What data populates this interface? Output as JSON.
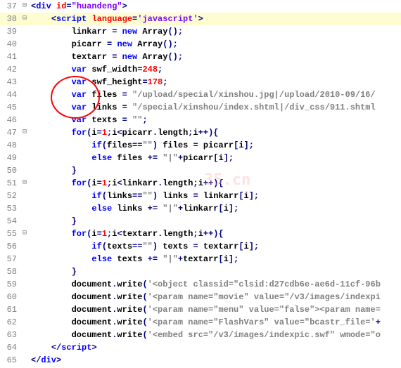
{
  "watermark": "35.cn",
  "lines": [
    {
      "n": 37,
      "fold": "⊟",
      "indent": 0,
      "hl": false,
      "tokens": [
        {
          "c": "op",
          "t": "<"
        },
        {
          "c": "tag",
          "t": "div "
        },
        {
          "c": "attrn",
          "t": "id"
        },
        {
          "c": "op",
          "t": "="
        },
        {
          "c": "attrv",
          "t": "\"huandeng\""
        },
        {
          "c": "op",
          "t": ">"
        }
      ]
    },
    {
      "n": 38,
      "fold": "⊟",
      "indent": 1,
      "hl": true,
      "tokens": [
        {
          "c": "op",
          "t": "<"
        },
        {
          "c": "tag",
          "t": "script "
        },
        {
          "c": "attrn",
          "t": "language"
        },
        {
          "c": "op",
          "t": "="
        },
        {
          "c": "attrv",
          "t": "'javascript'"
        },
        {
          "c": "op",
          "t": ">"
        }
      ]
    },
    {
      "n": 39,
      "fold": "",
      "indent": 2,
      "hl": false,
      "tokens": [
        {
          "c": "ident",
          "t": "linkarr "
        },
        {
          "c": "op",
          "t": "= "
        },
        {
          "c": "kw",
          "t": "new"
        },
        {
          "c": "ident",
          "t": " Array"
        },
        {
          "c": "op",
          "t": "();"
        }
      ]
    },
    {
      "n": 40,
      "fold": "",
      "indent": 2,
      "hl": false,
      "tokens": [
        {
          "c": "ident",
          "t": "picarr "
        },
        {
          "c": "op",
          "t": "= "
        },
        {
          "c": "kw",
          "t": "new"
        },
        {
          "c": "ident",
          "t": " Array"
        },
        {
          "c": "op",
          "t": "();"
        }
      ]
    },
    {
      "n": 41,
      "fold": "",
      "indent": 2,
      "hl": false,
      "tokens": [
        {
          "c": "ident",
          "t": "textarr "
        },
        {
          "c": "op",
          "t": "= "
        },
        {
          "c": "kw",
          "t": "new"
        },
        {
          "c": "ident",
          "t": " Array"
        },
        {
          "c": "op",
          "t": "();"
        }
      ]
    },
    {
      "n": 42,
      "fold": "",
      "indent": 2,
      "hl": false,
      "tokens": [
        {
          "c": "kw",
          "t": "var"
        },
        {
          "c": "ident",
          "t": " swf_width"
        },
        {
          "c": "op",
          "t": "="
        },
        {
          "c": "num",
          "t": "248"
        },
        {
          "c": "op",
          "t": ";"
        }
      ]
    },
    {
      "n": 43,
      "fold": "",
      "indent": 2,
      "hl": false,
      "tokens": [
        {
          "c": "kw",
          "t": "var"
        },
        {
          "c": "ident",
          "t": " swf_height"
        },
        {
          "c": "op",
          "t": "="
        },
        {
          "c": "num",
          "t": "178"
        },
        {
          "c": "op",
          "t": ";"
        }
      ]
    },
    {
      "n": 44,
      "fold": "",
      "indent": 2,
      "hl": false,
      "tokens": [
        {
          "c": "kw",
          "t": "var"
        },
        {
          "c": "ident",
          "t": " files "
        },
        {
          "c": "op",
          "t": "= "
        },
        {
          "c": "str",
          "t": "\"/upload/special/xinshou.jpg|/upload/2010-09/16/"
        }
      ]
    },
    {
      "n": 45,
      "fold": "",
      "indent": 2,
      "hl": false,
      "tokens": [
        {
          "c": "kw",
          "t": "var"
        },
        {
          "c": "ident",
          "t": " links "
        },
        {
          "c": "op",
          "t": "= "
        },
        {
          "c": "str",
          "t": "\"/special/xinshou/index.shtml|/div_css/911.shtml"
        }
      ]
    },
    {
      "n": 46,
      "fold": "",
      "indent": 2,
      "hl": false,
      "tokens": [
        {
          "c": "kw",
          "t": "var"
        },
        {
          "c": "ident",
          "t": " texts "
        },
        {
          "c": "op",
          "t": "= "
        },
        {
          "c": "str",
          "t": "\"\""
        },
        {
          "c": "op",
          "t": ";"
        }
      ]
    },
    {
      "n": 47,
      "fold": "⊟",
      "indent": 2,
      "hl": false,
      "tokens": [
        {
          "c": "kw",
          "t": "for"
        },
        {
          "c": "op",
          "t": "("
        },
        {
          "c": "ident",
          "t": "i"
        },
        {
          "c": "op",
          "t": "="
        },
        {
          "c": "num",
          "t": "1"
        },
        {
          "c": "op",
          "t": ";"
        },
        {
          "c": "ident",
          "t": "i"
        },
        {
          "c": "op",
          "t": "<"
        },
        {
          "c": "ident",
          "t": "picarr"
        },
        {
          "c": "op",
          "t": "."
        },
        {
          "c": "ident",
          "t": "length"
        },
        {
          "c": "op",
          "t": ";"
        },
        {
          "c": "ident",
          "t": "i"
        },
        {
          "c": "op",
          "t": "++){"
        }
      ]
    },
    {
      "n": 48,
      "fold": "",
      "indent": 3,
      "hl": false,
      "tokens": [
        {
          "c": "kw",
          "t": "if"
        },
        {
          "c": "op",
          "t": "("
        },
        {
          "c": "ident",
          "t": "files"
        },
        {
          "c": "op",
          "t": "=="
        },
        {
          "c": "str",
          "t": "\"\""
        },
        {
          "c": "op",
          "t": ") "
        },
        {
          "c": "ident",
          "t": "files "
        },
        {
          "c": "op",
          "t": "= "
        },
        {
          "c": "ident",
          "t": "picarr"
        },
        {
          "c": "op",
          "t": "["
        },
        {
          "c": "ident",
          "t": "i"
        },
        {
          "c": "op",
          "t": "];"
        }
      ]
    },
    {
      "n": 49,
      "fold": "",
      "indent": 3,
      "hl": false,
      "tokens": [
        {
          "c": "kw",
          "t": "else"
        },
        {
          "c": "ident",
          "t": " files "
        },
        {
          "c": "op",
          "t": "+= "
        },
        {
          "c": "str",
          "t": "\"|\""
        },
        {
          "c": "op",
          "t": "+"
        },
        {
          "c": "ident",
          "t": "picarr"
        },
        {
          "c": "op",
          "t": "["
        },
        {
          "c": "ident",
          "t": "i"
        },
        {
          "c": "op",
          "t": "];"
        }
      ]
    },
    {
      "n": 50,
      "fold": "",
      "indent": 2,
      "hl": false,
      "tokens": [
        {
          "c": "op",
          "t": "}"
        }
      ]
    },
    {
      "n": 51,
      "fold": "⊟",
      "indent": 2,
      "hl": false,
      "tokens": [
        {
          "c": "kw",
          "t": "for"
        },
        {
          "c": "op",
          "t": "("
        },
        {
          "c": "ident",
          "t": "i"
        },
        {
          "c": "op",
          "t": "="
        },
        {
          "c": "num",
          "t": "1"
        },
        {
          "c": "op",
          "t": ";"
        },
        {
          "c": "ident",
          "t": "i"
        },
        {
          "c": "op",
          "t": "<"
        },
        {
          "c": "ident",
          "t": "linkarr"
        },
        {
          "c": "op",
          "t": "."
        },
        {
          "c": "ident",
          "t": "length"
        },
        {
          "c": "op",
          "t": ";"
        },
        {
          "c": "ident",
          "t": "i"
        },
        {
          "c": "op",
          "t": "++){"
        }
      ]
    },
    {
      "n": 52,
      "fold": "",
      "indent": 3,
      "hl": false,
      "tokens": [
        {
          "c": "kw",
          "t": "if"
        },
        {
          "c": "op",
          "t": "("
        },
        {
          "c": "ident",
          "t": "links"
        },
        {
          "c": "op",
          "t": "=="
        },
        {
          "c": "str",
          "t": "\"\""
        },
        {
          "c": "op",
          "t": ") "
        },
        {
          "c": "ident",
          "t": "links "
        },
        {
          "c": "op",
          "t": "= "
        },
        {
          "c": "ident",
          "t": "linkarr"
        },
        {
          "c": "op",
          "t": "["
        },
        {
          "c": "ident",
          "t": "i"
        },
        {
          "c": "op",
          "t": "];"
        }
      ]
    },
    {
      "n": 53,
      "fold": "",
      "indent": 3,
      "hl": false,
      "tokens": [
        {
          "c": "kw",
          "t": "else"
        },
        {
          "c": "ident",
          "t": " links "
        },
        {
          "c": "op",
          "t": "+= "
        },
        {
          "c": "str",
          "t": "\"|\""
        },
        {
          "c": "op",
          "t": "+"
        },
        {
          "c": "ident",
          "t": "linkarr"
        },
        {
          "c": "op",
          "t": "["
        },
        {
          "c": "ident",
          "t": "i"
        },
        {
          "c": "op",
          "t": "];"
        }
      ]
    },
    {
      "n": 54,
      "fold": "",
      "indent": 2,
      "hl": false,
      "tokens": [
        {
          "c": "op",
          "t": "}"
        }
      ]
    },
    {
      "n": 55,
      "fold": "⊟",
      "indent": 2,
      "hl": false,
      "tokens": [
        {
          "c": "kw",
          "t": "for"
        },
        {
          "c": "op",
          "t": "("
        },
        {
          "c": "ident",
          "t": "i"
        },
        {
          "c": "op",
          "t": "="
        },
        {
          "c": "num",
          "t": "1"
        },
        {
          "c": "op",
          "t": ";"
        },
        {
          "c": "ident",
          "t": "i"
        },
        {
          "c": "op",
          "t": "<"
        },
        {
          "c": "ident",
          "t": "textarr"
        },
        {
          "c": "op",
          "t": "."
        },
        {
          "c": "ident",
          "t": "length"
        },
        {
          "c": "op",
          "t": ";"
        },
        {
          "c": "ident",
          "t": "i"
        },
        {
          "c": "op",
          "t": "++){"
        }
      ]
    },
    {
      "n": 56,
      "fold": "",
      "indent": 3,
      "hl": false,
      "tokens": [
        {
          "c": "kw",
          "t": "if"
        },
        {
          "c": "op",
          "t": "("
        },
        {
          "c": "ident",
          "t": "texts"
        },
        {
          "c": "op",
          "t": "=="
        },
        {
          "c": "str",
          "t": "\"\""
        },
        {
          "c": "op",
          "t": ") "
        },
        {
          "c": "ident",
          "t": "texts "
        },
        {
          "c": "op",
          "t": "= "
        },
        {
          "c": "ident",
          "t": "textarr"
        },
        {
          "c": "op",
          "t": "["
        },
        {
          "c": "ident",
          "t": "i"
        },
        {
          "c": "op",
          "t": "];"
        }
      ]
    },
    {
      "n": 57,
      "fold": "",
      "indent": 3,
      "hl": false,
      "tokens": [
        {
          "c": "kw",
          "t": "else"
        },
        {
          "c": "ident",
          "t": " texts "
        },
        {
          "c": "op",
          "t": "+= "
        },
        {
          "c": "str",
          "t": "\"|\""
        },
        {
          "c": "op",
          "t": "+"
        },
        {
          "c": "ident",
          "t": "textarr"
        },
        {
          "c": "op",
          "t": "["
        },
        {
          "c": "ident",
          "t": "i"
        },
        {
          "c": "op",
          "t": "];"
        }
      ]
    },
    {
      "n": 58,
      "fold": "",
      "indent": 2,
      "hl": false,
      "tokens": [
        {
          "c": "op",
          "t": "}"
        }
      ]
    },
    {
      "n": 59,
      "fold": "",
      "indent": 2,
      "hl": false,
      "tokens": [
        {
          "c": "ident",
          "t": "document"
        },
        {
          "c": "op",
          "t": "."
        },
        {
          "c": "ident",
          "t": "write"
        },
        {
          "c": "op",
          "t": "("
        },
        {
          "c": "str",
          "t": "'<object classid=\"clsid:d27cdb6e-ae6d-11cf-96b"
        }
      ]
    },
    {
      "n": 60,
      "fold": "",
      "indent": 2,
      "hl": false,
      "tokens": [
        {
          "c": "ident",
          "t": "document"
        },
        {
          "c": "op",
          "t": "."
        },
        {
          "c": "ident",
          "t": "write"
        },
        {
          "c": "op",
          "t": "("
        },
        {
          "c": "str",
          "t": "'<param name=\"movie\" value=\"/v3/images/indexpi"
        }
      ]
    },
    {
      "n": 61,
      "fold": "",
      "indent": 2,
      "hl": false,
      "tokens": [
        {
          "c": "ident",
          "t": "document"
        },
        {
          "c": "op",
          "t": "."
        },
        {
          "c": "ident",
          "t": "write"
        },
        {
          "c": "op",
          "t": "("
        },
        {
          "c": "str",
          "t": "'<param name=\"menu\" value=\"false\"><param name="
        }
      ]
    },
    {
      "n": 62,
      "fold": "",
      "indent": 2,
      "hl": false,
      "tokens": [
        {
          "c": "ident",
          "t": "document"
        },
        {
          "c": "op",
          "t": "."
        },
        {
          "c": "ident",
          "t": "write"
        },
        {
          "c": "op",
          "t": "("
        },
        {
          "c": "str",
          "t": "'<param name=\"FlashVars\" value=\"bcastr_file='"
        },
        {
          "c": "op",
          "t": "+"
        }
      ]
    },
    {
      "n": 63,
      "fold": "",
      "indent": 2,
      "hl": false,
      "tokens": [
        {
          "c": "ident",
          "t": "document"
        },
        {
          "c": "op",
          "t": "."
        },
        {
          "c": "ident",
          "t": "write"
        },
        {
          "c": "op",
          "t": "("
        },
        {
          "c": "str",
          "t": "'<embed src=\"/v3/images/indexpic.swf\" wmode=\"o"
        }
      ]
    },
    {
      "n": 64,
      "fold": "",
      "indent": 1,
      "hl": false,
      "tokens": [
        {
          "c": "op",
          "t": "</"
        },
        {
          "c": "tag",
          "t": "script"
        },
        {
          "c": "op",
          "t": ">"
        }
      ]
    },
    {
      "n": 65,
      "fold": "",
      "indent": 0,
      "hl": false,
      "tokens": [
        {
          "c": "op",
          "t": "</"
        },
        {
          "c": "tag",
          "t": "div"
        },
        {
          "c": "op",
          "t": ">"
        }
      ]
    }
  ]
}
